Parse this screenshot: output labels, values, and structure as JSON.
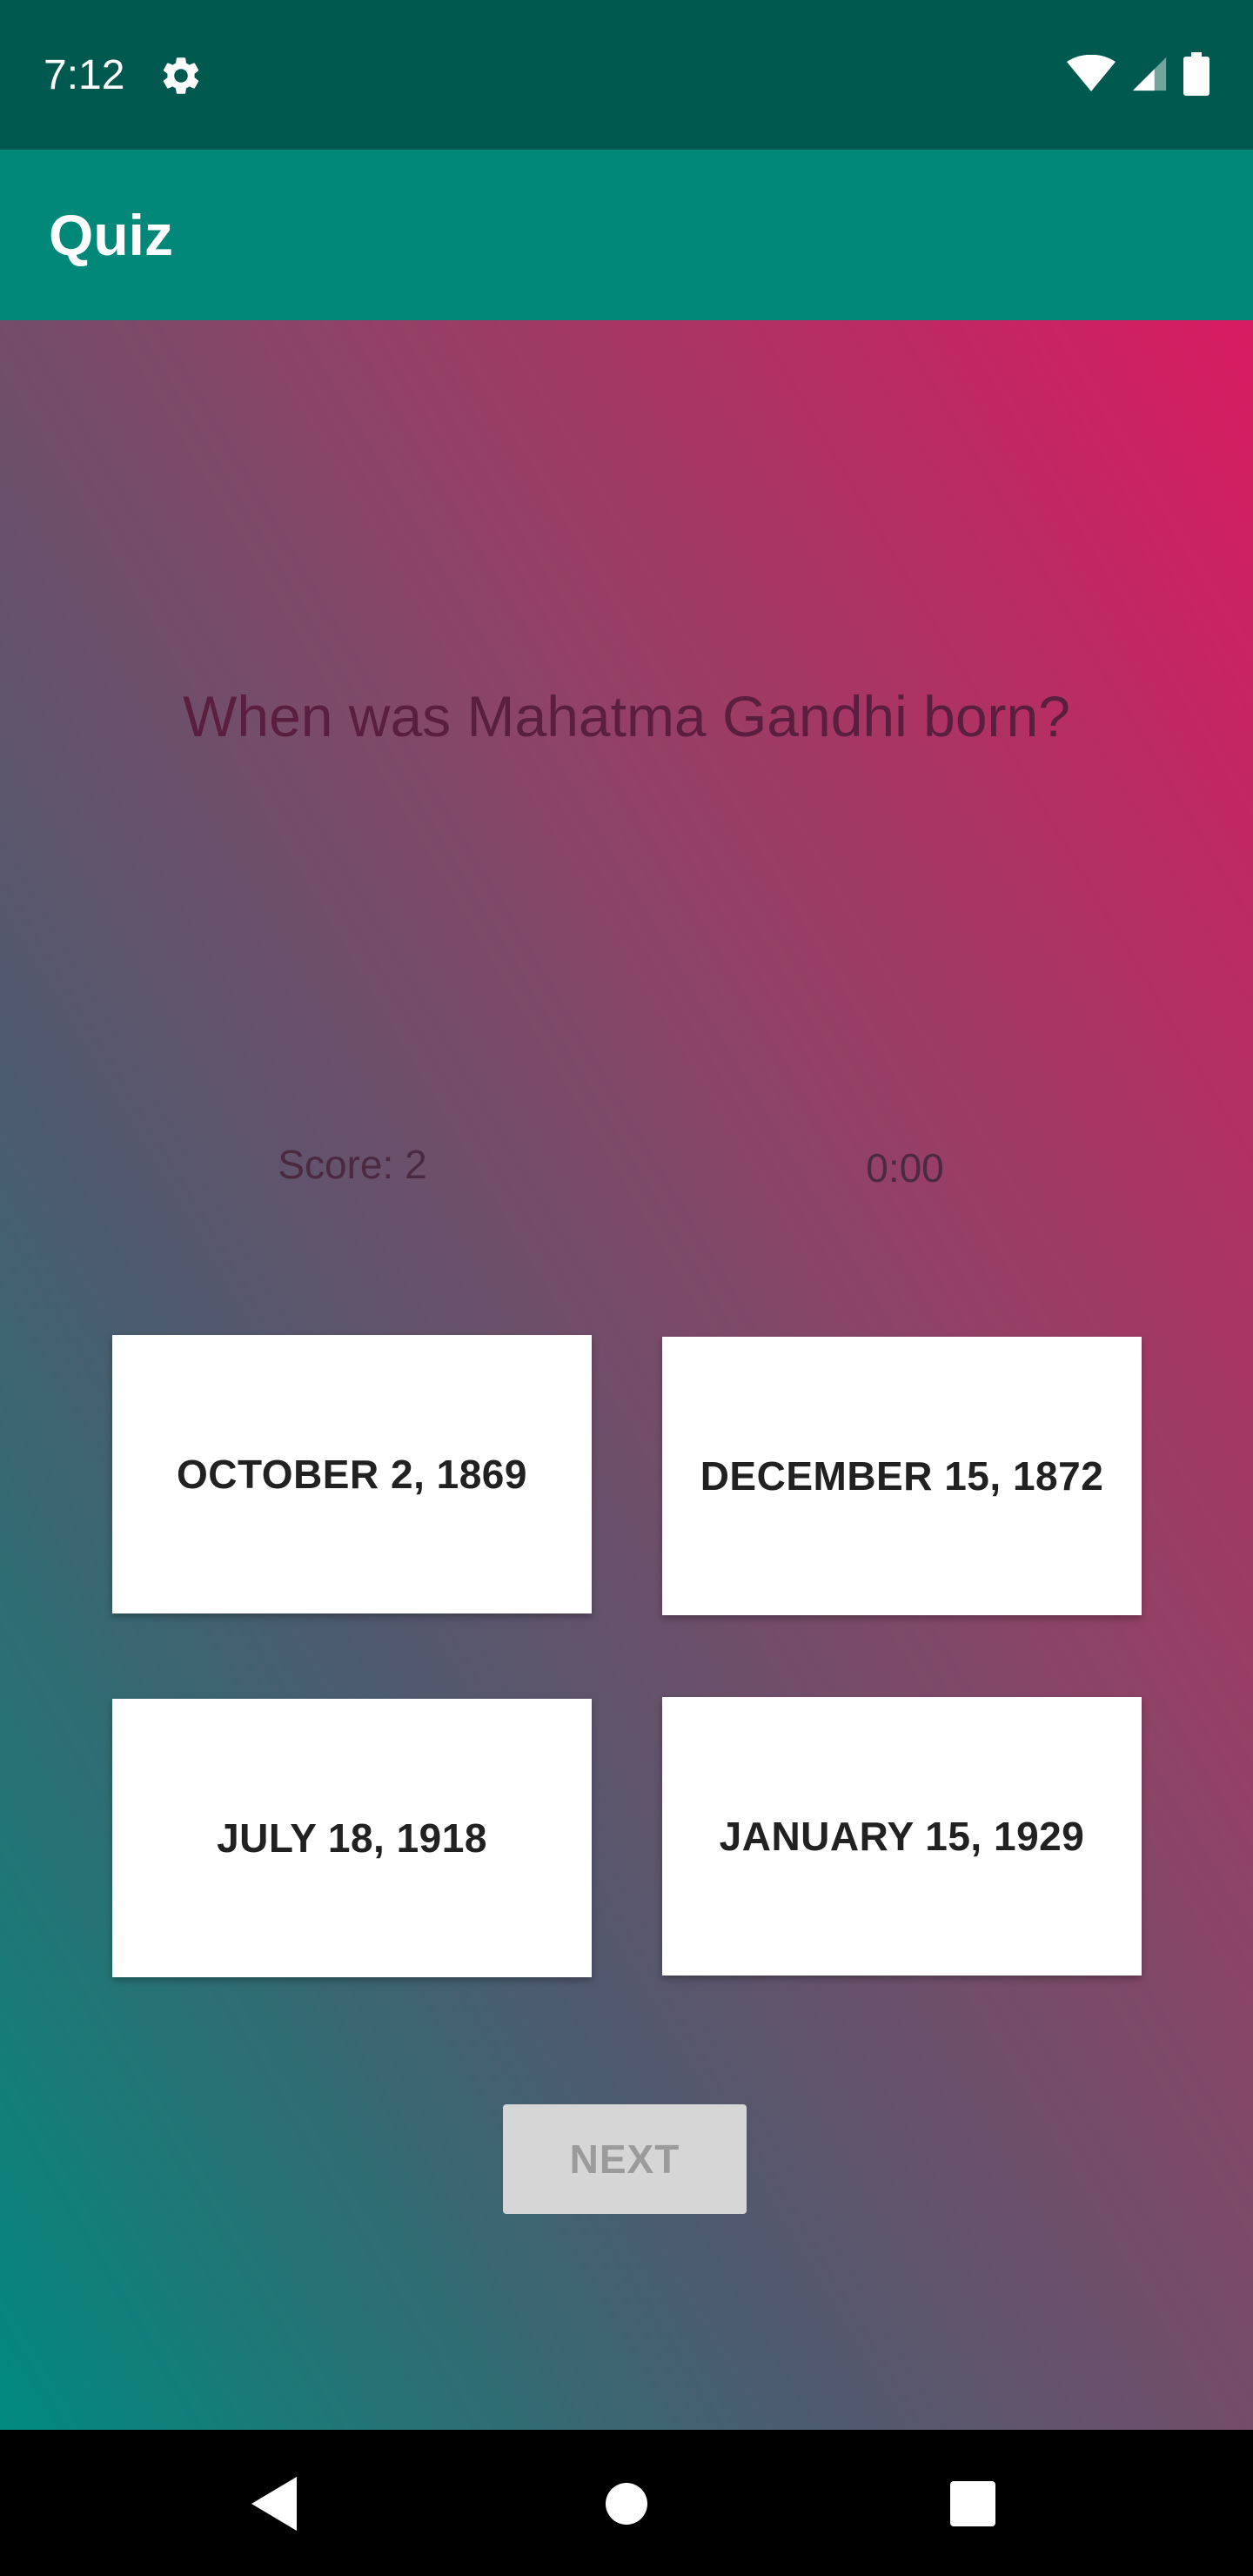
{
  "status_bar": {
    "time": "7:12",
    "icons": [
      "gear-icon",
      "wifi-icon",
      "signal-icon",
      "battery-icon"
    ]
  },
  "app_bar": {
    "title": "Quiz"
  },
  "quiz": {
    "question": "When was Mahatma Gandhi born?",
    "score": "Score: 2",
    "timer": "0:00",
    "answers": [
      "OCTOBER 2, 1869",
      "DECEMBER 15, 1872",
      "JULY 18, 1918",
      "JANUARY 15, 1929"
    ],
    "next_label": "NEXT"
  },
  "nav_bar": {
    "icons": [
      "back-icon",
      "home-icon",
      "recents-icon"
    ]
  },
  "colors": {
    "status_bar": "#00594e",
    "app_bar": "#028878",
    "gradient_bottom_left": "#008a7c",
    "gradient_top_right": "#d91b62",
    "next_disabled": "#d6d6d6"
  }
}
